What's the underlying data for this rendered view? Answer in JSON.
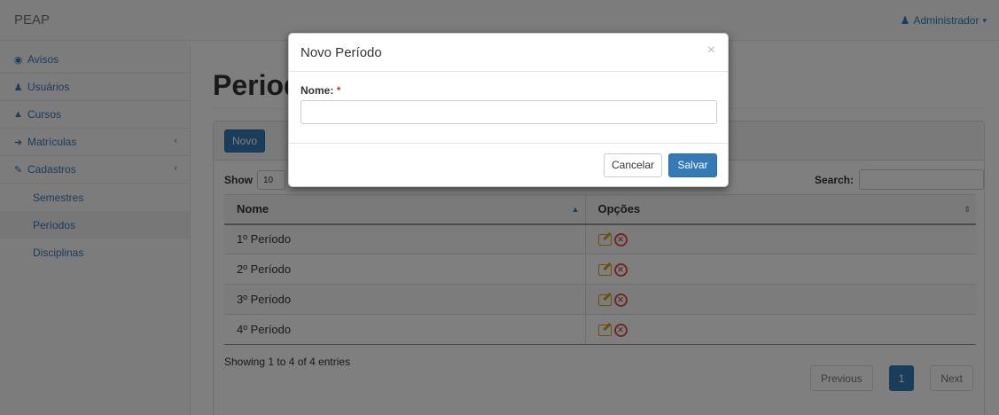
{
  "navbar": {
    "brand": "PEAP",
    "user_label": "Administrador",
    "user_icon": "user-icon",
    "caret": "▾"
  },
  "sidebar": {
    "items": [
      {
        "label": "Avisos",
        "icon": "dashboard-icon"
      },
      {
        "label": "Usuários",
        "icon": "user-icon"
      },
      {
        "label": "Cursos",
        "icon": "graduation-cap-icon"
      },
      {
        "label": "Matrículas",
        "icon": "sign-in-icon",
        "arrow": "‹"
      },
      {
        "label": "Cadastros",
        "icon": "edit-icon",
        "arrow": "‹"
      }
    ],
    "subitems": [
      {
        "label": "Semestres"
      },
      {
        "label": "Períodos"
      },
      {
        "label": "Disciplinas"
      }
    ]
  },
  "main": {
    "page_title": "Period",
    "new_button": "Novo",
    "show_label": "Show",
    "show_value": "10",
    "search_label": "Search:",
    "table": {
      "headers": [
        "Nome",
        "Opções"
      ],
      "rows": [
        {
          "nome": "1º Período"
        },
        {
          "nome": "2º Período"
        },
        {
          "nome": "3º Período"
        },
        {
          "nome": "4º Período"
        }
      ]
    },
    "info": "Showing 1 to 4 of 4 entries",
    "pagination": {
      "previous": "Previous",
      "current": "1",
      "next": "Next"
    }
  },
  "modal": {
    "title": "Novo Período",
    "close": "×",
    "field_label": "Nome:",
    "required_mark": "*",
    "input_value": "",
    "cancel": "Cancelar",
    "save": "Salvar"
  },
  "colors": {
    "primary": "#337ab7",
    "warning": "#d4a017",
    "danger": "#d9534f"
  }
}
